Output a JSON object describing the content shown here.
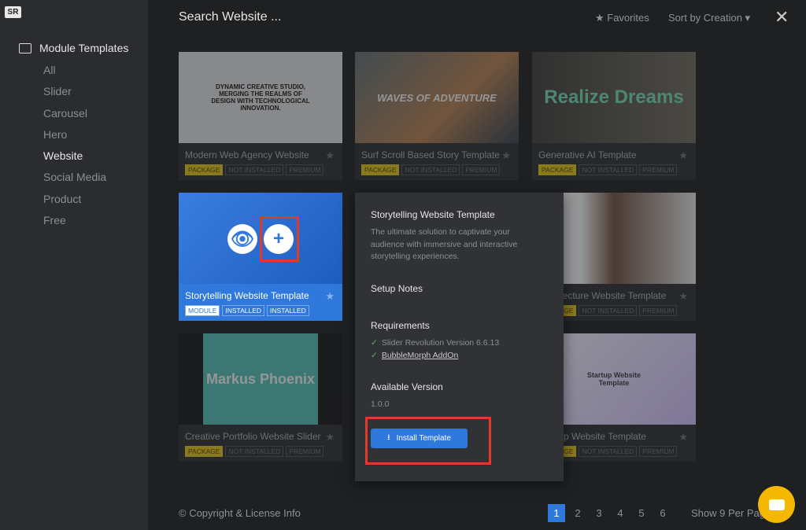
{
  "sidebar": {
    "logo": "SR",
    "section": "Module Templates",
    "items": [
      "All",
      "Slider",
      "Carousel",
      "Hero",
      "Website",
      "Social Media",
      "Product",
      "Free"
    ],
    "active": "Website"
  },
  "header": {
    "search_placeholder": "Search Website ...",
    "favorites": "★ Favorites",
    "sort": "Sort by Creation ▾",
    "close": "✕"
  },
  "cards": [
    {
      "title": "Modern Web Agency Website",
      "tags": [
        "PACKAGE",
        "NOT INSTALLED",
        "PREMIUM"
      ],
      "thumb_text": "DYNAMIC CREATIVE STUDIO, MERGING THE REALMS OF DESIGN WITH TECHNOLOGICAL INNOVATION."
    },
    {
      "title": "Surf Scroll Based Story Template",
      "tags": [
        "PACKAGE",
        "NOT INSTALLED",
        "PREMIUM"
      ],
      "thumb_text": "WAVES OF ADVENTURE"
    },
    {
      "title": "Generative AI Template",
      "tags": [
        "PACKAGE",
        "NOT INSTALLED",
        "PREMIUM"
      ],
      "thumb_text": "Realize Dreams"
    },
    {
      "title": "Storytelling Website Template",
      "tags": [
        "MODULE",
        "INSTALLED",
        "INSTALLED"
      ],
      "thumb_text": ""
    },
    {
      "title": "Architecture Website Template",
      "tags": [
        "PACKAGE",
        "NOT INSTALLED",
        "PREMIUM"
      ],
      "thumb_text": ""
    },
    {
      "title": "Creative Portfolio Website Slider",
      "tags": [
        "PACKAGE",
        "NOT INSTALLED",
        "PREMIUM"
      ],
      "thumb_text": "Markus Phoenix"
    },
    {
      "title": "Startup Website Template",
      "tags": [
        "PACKAGE",
        "NOT INSTALLED",
        "PREMIUM"
      ],
      "thumb_text": "Startup Website Template"
    }
  ],
  "popup": {
    "title": "Storytelling Website Template",
    "description": "The ultimate solution to captivate your audience with immersive and interactive storytelling experiences.",
    "setup_notes": "Setup Notes",
    "requirements_label": "Requirements",
    "requirements": [
      "Slider Revolution Version 6.6.13",
      "BubbleMorph AddOn"
    ],
    "version_label": "Available Version",
    "version": "1.0.0",
    "install": "Install Template"
  },
  "footer": {
    "copyright": "© Copyright & License Info",
    "pages": [
      "1",
      "2",
      "3",
      "4",
      "5",
      "6"
    ],
    "current_page": "1",
    "per_page": "Show 9 Per Page"
  },
  "colors": {
    "accent": "#2f78dc",
    "highlight": "#e03a2a",
    "chat": "#f5b800"
  }
}
